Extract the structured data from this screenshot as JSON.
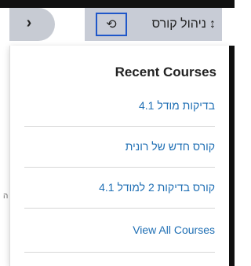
{
  "top_controls": {
    "collapse_symbol": "›",
    "manage_label": "ניהול קורס",
    "sort_symbol": "↕",
    "history_symbol": "⟲"
  },
  "recent_courses": {
    "title": "Recent Courses",
    "items": [
      "בדיקות מודל 4.1",
      "קורס חדש של רונית",
      "קורס בדיקות 2 למודל 4.1"
    ],
    "view_all": "View All Courses"
  },
  "background_fragment": "ה"
}
